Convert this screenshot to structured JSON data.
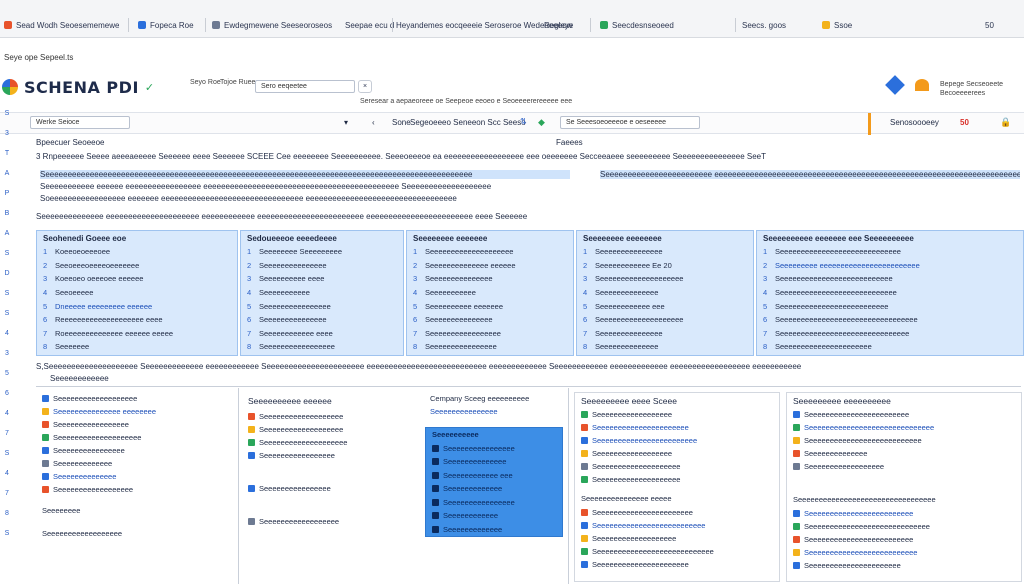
{
  "tabs": [
    {
      "label": "Sead Wodh Seoesememewe"
    },
    {
      "label": "Fopeca Roe"
    },
    {
      "label": "Ewdegmewene Seeseoroseos"
    },
    {
      "label": "Seepae ecu d"
    },
    {
      "label": "Heyandemes eocqeeeie Seroseroe Wedeoeeeow"
    },
    {
      "label": "Regleye"
    },
    {
      "label": "Seecdesnseoeed"
    },
    {
      "label": "Seecs. goos"
    },
    {
      "label": "Ssoe"
    },
    {
      "label": "50"
    }
  ],
  "menubar": {
    "text": "Seye ope Sepeel.ts"
  },
  "brand": {
    "title": "SCHENA PDI",
    "mini1": "Seyo Roe",
    "mini2": "Tojoe Ruee"
  },
  "top_controls": {
    "search_label": "Sero eeqeetee",
    "hint": "Seresear a aepaeoreee oe Seepeoe eeoeo e Seoeeeerereeeee eee",
    "right_btn": "Bepege Secseoeete Becoeeeerees"
  },
  "toolbar2": {
    "dropdown": "Werke Seioce",
    "nav": "Sone",
    "mid": "Segeoeeeo Seneeon Scc Seeso",
    "right_search": "Se Seeesoeoeeeoe e oeseeeee",
    "far_right": "Senosoooeey",
    "page": "50"
  },
  "leftrail": [
    "S",
    "3",
    "T",
    "A",
    "P",
    "B",
    "A",
    "S",
    "D",
    "S",
    "S",
    "4",
    "3",
    "5",
    "6",
    "4",
    "7",
    "S",
    "4",
    "7",
    "8",
    "S"
  ],
  "breadcrumb": "Bpeecuer Seoeeoe",
  "sheet_tab": "Faeees",
  "body_lines": [
    "3 Rnpeeeeee Seeee aeeeaeeeee Seeeeee eeee Seeeeee SCEEE Cee eeeeeeee Seeeeeeeeee. Seeeoeeeoe ea eeeeeeeeeeeeeeeeee eee oeeeeeee Secceeaeee seeeeeeeee Seeeeeeeeeeeeeee SeeT",
    "Seeeeeeeeeeeeeeeeeeeeeeeeeeeeeeeeeeeeeeeeeeeeeeeeeeeeeeeeeeeeeeeeeeeeeeeeeeeeeeeeeeeeeeeeeeeeeeee",
    "Seeeeeeeeeee eeeeee eeeeeeeeeeeeeeeee eeeeeeeeeeeeeeeeeeeeeeeeeeeeeeeeeeeeeeeeeeee Seeeeeeeeeeeeeeeeeee",
    "Seeeeeeeeeeeeeeeeeeeeeeee eeeeeeeeeeeeeeeeeeeeeeeeeeeeeeeeeeeeeeeeeeeeeeeeeeeeeeeeeeeeeeeeeeeeeeee",
    "Soeeeeeeeeeeeeeeeee eeeeeee eeeeeeeeeeeeeeeeeeeeeeeeeeeeeeee eeeeeeeeeeeeeeeeeeeeeeeeeeeeeeeeee",
    "Seeeeeeeeeeeeee eeeeeeeeeeeeeeeeeeeee eeeeeeeeeeee eeeeeeeeeeeeeeeeeeeeeeee eeeeeeeeeeeeeeeeeeeeeeee eeee Seeeeee"
  ],
  "panels": [
    {
      "head": "Seohenedi Goeee eoe",
      "rows": [
        "Koeeoeoeeeoee",
        "Seeoeeeoeeeeoeeeeeee",
        "Koeeoeo oeeeoee eeeeee",
        "Seeoeeeee",
        "Dneeeee eeeeeeeee eeeeee",
        "Reeeeeeeeeeeeeeeeeeee eeee",
        "Roeeeeeeeeeeeeee eeeeee eeeee",
        "Seeeeeee"
      ]
    },
    {
      "head": "Sedoueeeoe eeeedeeee",
      "rows": [
        "Seeeeeeee Seeeeeeeee",
        "Seeeeeeeeeeeeeee",
        "Seeeeeeeeee eeee",
        "Seeeeeeeeeee",
        "Seeeeeeeeeeeeeeee",
        "Seeeeeeeeeeeeeee",
        "Seeeeeeeeeeee eeee",
        "Seeeeeeeeeeeeeeeee"
      ]
    },
    {
      "head": "Seeeeeeee eeeeeee",
      "rows": [
        "Seeeeeeeeeeeeeeeeeeee",
        "Seeeeeeeeeeeeee eeeeee",
        "Seeeeeeeeeeeeeee",
        "Seeeeeeeeeee",
        "Seeeeeeeeee eeeeeee",
        "Seeeeeeeeeeeeeee",
        "Seeeeeeeeeeeeeeeee",
        "Seeeeeeeeeeeeeeee"
      ]
    },
    {
      "head": "Seeeeeeee eeeeeeee",
      "rows": [
        "Seeeeeeeeeeeeeee",
        "Seeeeeeeeeeee Ee 20",
        "Seeeeeeeeeeeeeeeeeeee",
        "Seeeeeeeeeeeeee",
        "Seeeeeeeeeeee eee",
        "Seeeeeeeeeeeeeeeeeeee",
        "Seeeeeeeeeeeeeee",
        "Seeeeeeeeeeeeee"
      ]
    },
    {
      "head": "Seeeeeeeeee eeeeeee eee Seeeeeeeeee",
      "rows": [
        "Seeeeeeeeeeeeeeeeeeeeeeeeeeeee",
        "Seeeeeeeee eeeeeeeeeeeeeeeeeeeeeeee",
        "Seeeeeeeeeeeeeeeeeeeeeeeeeee",
        "Seeeeeeeeeeeeeeeeeeeeeeeeeeee",
        "Seeeeeeeeeeeeeeeeeeeeeeeeee",
        "Seeeeeeeeeeeeeeeeeeeeeeeeeeeeeeeee",
        "Seeeeeeeeeeeeeeeeeeeeeeeeeeeeeee",
        "Seeeeeeeeeeeeeeeeeeeeee"
      ]
    }
  ],
  "subheader": "S,Seeeeeeeeeeeeeeeeeeee Seeeeeeeeeeeee eeeeeeeeeeee Seeeeeeeeeeeeeeeeeeeeee eeeeeeeeeeeeeeeeeeeeeeeeeee eeeeeeeeeeeee Seeeeeeeeeeee eeeeeeeeeeeee eeeeeeeeeeeeeeeeee eeeeeeeeeee",
  "subheader2": "Seeeeeeeeeeee",
  "cards": {
    "c1": {
      "rows": [
        "Seeeeeeeeeeeeeeeeeee",
        "Seeeeeeeeeeeeeee eeeeeeee",
        "Seeeeeeeeeeeeeeeee",
        "Seeeeeeeeeeeeeeeeeeee",
        "Seeeeeeeeeeeeeeee",
        "Seeeeeeeeeeeee",
        "Seeeeeeeeeeeeee",
        "Seeeeeeeeeeeeeeeeee"
      ],
      "footer": "Seeeeeeee",
      "footer2": "Seeeeeeeeeeeeeeeeee"
    },
    "c2": {
      "title": "Seeeeeeeeee eeeeee",
      "rows": [
        "Seeeeeeeeeeeeeeeeeee",
        "Seeeeeeeeeeeeeeeeeee",
        "Seeeeeeeeeeeeeeeeeeee",
        "Seeeeeeeeeeeeeeeee"
      ],
      "footer": "Seeeeeeeeeeeeeeee",
      "footer2": "Seeeeeeeeeeeeeeeeee"
    },
    "c3": {
      "title": "Cempany Sceeg eeeeeeeeee",
      "sub": "Seeeeeeeeeeeeeee"
    },
    "blue": {
      "title": "Seeeeeeeeee",
      "rows": [
        "Seeeeeeeeeeeeeeee",
        "Seeeeeeeeeeeeee",
        "Seeeeeeeeeeee eee",
        "Seeeeeeeeeeeee",
        "Seeeeeeeeeeeeeeee",
        "Seeeeeeeeeeee",
        "Seeeeeeeeeeeee"
      ]
    },
    "c4": {
      "title": "Seeeeeeeee eeee Sceee",
      "rows": [
        "Seeeeeeeeeeeeeeeeee",
        "Seeeeeeeeeeeeeeeeeeeeee",
        "Seeeeeeeeeeeeeeeeeeeeeeee",
        "Seeeeeeeeeeeeeeeeee",
        "Seeeeeeeeeeeeeeeeeeee",
        "Seeeeeeeeeeeeeeeeeeee"
      ],
      "section": "Seeeeeeeeeeeeeee eeeee",
      "rows2": [
        "Seeeeeeeeeeeeeeeeeeeeeee",
        "Seeeeeeeeeeeeeeeeeeeeeeeeee",
        "Seeeeeeeeeeeeeeeeeee",
        "Seeeeeeeeeeeeeeeeeeeeeeeeeeee",
        "Seeeeeeeeeeeeeeeeeeeeee"
      ]
    },
    "c5": {
      "title": "Seeeeeeeee eeeeeeeeee",
      "rows": [
        "Seeeeeeeeeeeeeeeeeeeeeeee",
        "Seeeeeeeeeeeeeeeeeeeeeeeeeeeeee",
        "Seeeeeeeeeeeeeeeeeeeeeeeeeee",
        "Seeeeeeeeeeeeee",
        "Seeeeeeeeeeeeeeeeee"
      ],
      "section": "Seeeeeeeeeeeeeeeeeeeeeeeeeeeeeeeee",
      "rows2": [
        "Seeeeeeeeeeeeeeeeeeeeeeeee",
        "Seeeeeeeeeeeeeeeeeeeeeeeeeeeee",
        "Seeeeeeeeeeeeeeeeeeeeeeeee",
        "Seeeeeeeeeeeeeeeeeeeeeeeeee",
        "Seeeeeeeeeeeeeeeeeeeeee"
      ]
    }
  }
}
